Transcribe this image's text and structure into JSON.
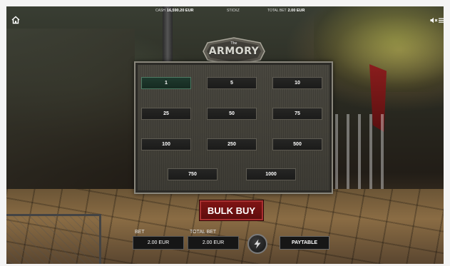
{
  "top_bar": {
    "cash_label": "Cash",
    "cash_value": "16,590.20 EUR",
    "center_label": "Stickz",
    "total_bet_label": "Total bet",
    "total_bet_value": "2.00 EUR"
  },
  "logo": {
    "small_text": "The",
    "title": "ARMORY"
  },
  "bulk_panel": {
    "selected_quantity": "1",
    "quantities": [
      "1",
      "5",
      "10",
      "25",
      "50",
      "75",
      "100",
      "250",
      "500",
      "750",
      "1000"
    ]
  },
  "bulk_buy_button": "BULK BUY",
  "bottom_bar": {
    "bet_label": "Bet",
    "bet_value": "2.00 EUR",
    "total_bet_label": "Total bet",
    "total_bet_value": "2.00 EUR",
    "paytable_label": "PAYTABLE"
  },
  "icons": {
    "home": "home-icon",
    "sound": "speaker-muted-icon",
    "menu": "menu-icon",
    "spin": "lightning-icon"
  },
  "colors": {
    "bulk_buy_bg": "#7e1414",
    "selected_qty_bg": "#1f3a2e"
  }
}
